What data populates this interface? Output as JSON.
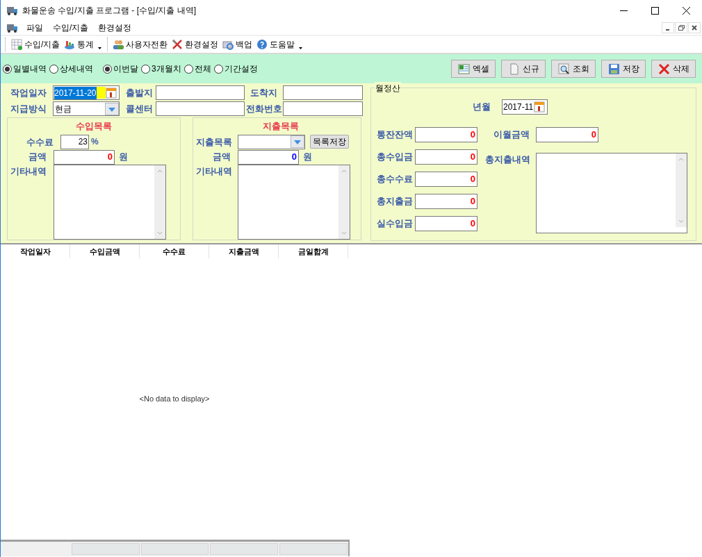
{
  "window": {
    "title": "화물운송 수입/지출 프로그램 - [수입/지출 내역]"
  },
  "menu": {
    "items": [
      {
        "label": "파일"
      },
      {
        "label": "수입/지출"
      },
      {
        "label": "환경설정"
      }
    ]
  },
  "toolbar": {
    "items": [
      {
        "label": "수입/지출",
        "kind": "grid",
        "dropdown": false
      },
      {
        "label": "통계",
        "kind": "chart",
        "dropdown": true
      },
      {
        "label": "사용자전환",
        "kind": "users",
        "dropdown": false
      },
      {
        "label": "환경설정",
        "kind": "tools",
        "dropdown": false
      },
      {
        "label": "백업",
        "kind": "backup",
        "dropdown": false
      },
      {
        "label": "도움말",
        "kind": "help",
        "dropdown": true
      }
    ]
  },
  "view_options": [
    {
      "label": "일별내역",
      "selected": true
    },
    {
      "label": "상세내역",
      "selected": false
    }
  ],
  "period_options": [
    {
      "label": "이번달",
      "selected": true
    },
    {
      "label": "3개월치",
      "selected": false
    },
    {
      "label": "전체",
      "selected": false
    },
    {
      "label": "기간설정",
      "selected": false
    }
  ],
  "action_buttons": [
    {
      "label": "엑셀",
      "kind": "excel"
    },
    {
      "label": "신규",
      "kind": "new"
    },
    {
      "label": "조회",
      "kind": "search"
    },
    {
      "label": "저장",
      "kind": "save"
    },
    {
      "label": "삭제",
      "kind": "delete"
    }
  ],
  "form": {
    "work_date": {
      "label": "작업일자",
      "value": "2017-11-20",
      "focused": true
    },
    "departure": {
      "label": "출발지"
    },
    "destination": {
      "label": "도착지"
    },
    "payment_method": {
      "label": "지급방식",
      "value": "현금"
    },
    "call_center": {
      "label": "콜센터"
    },
    "phone": {
      "label": "전화번호"
    }
  },
  "income": {
    "title": "수입목록",
    "fee": {
      "label": "수수료",
      "value": "23",
      "unit": "%"
    },
    "amount": {
      "label": "금액",
      "value": "0",
      "unit": "원",
      "color": "#ff0000"
    },
    "memo": {
      "label": "기타내역"
    }
  },
  "expense": {
    "title": "지출목록",
    "list": {
      "label": "지출목록"
    },
    "save_button": "목록저장",
    "amount": {
      "label": "금액",
      "value": "0",
      "unit": "원",
      "color": "#0000ff"
    },
    "memo": {
      "label": "기타내역"
    }
  },
  "monthly": {
    "title": "월정산",
    "year_month": {
      "label": "년월",
      "value": "2017-11"
    },
    "totals": [
      {
        "label": "통잔잔액",
        "value": "0"
      },
      {
        "label": "총수입금",
        "value": "0"
      },
      {
        "label": "총수수료",
        "value": "0"
      },
      {
        "label": "총지출금",
        "value": "0"
      },
      {
        "label": "실수입금",
        "value": "0"
      }
    ],
    "carryover": {
      "label": "이월금액",
      "value": "0"
    },
    "expense_memo": {
      "label": "총지출내역"
    }
  },
  "table": {
    "columns": [
      "작업일자",
      "수입금액",
      "수수료",
      "지출금액",
      "금일합계"
    ],
    "empty_message": "<No data to display>"
  }
}
